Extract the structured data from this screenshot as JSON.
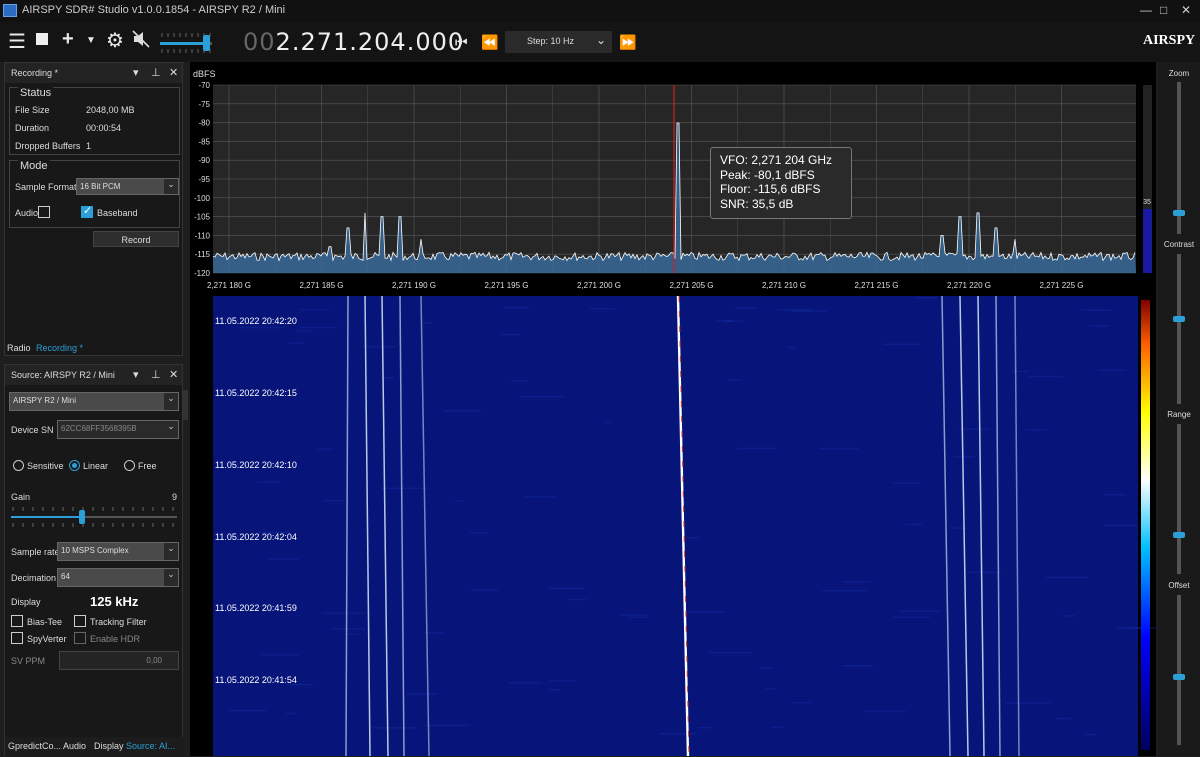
{
  "window": {
    "title": "AIRSPY SDR# Studio v1.0.0.1854 - AIRSPY R2 / Mini",
    "controls": [
      "—",
      "□",
      "✕"
    ]
  },
  "toolbar": {
    "freq_dim": "00",
    "freq_main": "2.271.204.000",
    "step_label": "Step: 10 Hz",
    "logo": "AIRSPY",
    "volume": 0.88
  },
  "recording_panel": {
    "title": "Recording *",
    "status_title": "Status",
    "file_size_label": "File Size",
    "file_size_value": "2048,00 MB",
    "duration_label": "Duration",
    "duration_value": "00:00:54",
    "dropped_label": "Dropped Buffers",
    "dropped_value": "1",
    "mode_title": "Mode",
    "sample_format_label": "Sample Format",
    "sample_format_value": "16 Bit PCM",
    "audio_label": "Audio",
    "audio_checked": false,
    "baseband_label": "Baseband",
    "baseband_checked": true,
    "record_button": "Record",
    "tab_radio": "Radio",
    "tab_recording": "Recording *"
  },
  "source_panel": {
    "title": "Source: AIRSPY R2 / Mini",
    "device_value": "AIRSPY R2 / Mini",
    "device_sn_label": "Device SN",
    "device_sn_value": "62CC68FF3568395B",
    "mode_sensitive": "Sensitive",
    "mode_linear": "Linear",
    "mode_free": "Free",
    "mode_selected": "Linear",
    "gain_label": "Gain",
    "gain_value": "9",
    "gain_fraction": 0.43,
    "sample_rate_label": "Sample rate",
    "sample_rate_value": "10 MSPS Complex",
    "decimation_label": "Decimation",
    "decimation_value": "64",
    "display_label": "Display",
    "display_value": "125 kHz",
    "bias_tee_label": "Bias-Tee",
    "tracking_filter_label": "Tracking Filter",
    "spyverter_label": "SpyVerter",
    "enable_hdr_label": "Enable HDR",
    "sv_ppm_label": "SV PPM",
    "sv_ppm_value": "0,00",
    "tabs": [
      "GpredictCo...",
      "Audio",
      "Display",
      "Source: AI..."
    ]
  },
  "spectrum": {
    "y_unit": "dBFS",
    "y_ticks": [
      "-70",
      "-75",
      "-80",
      "-85",
      "-90",
      "-95",
      "-100",
      "-105",
      "-110",
      "-115",
      "-120"
    ],
    "x_ticks": [
      "2,271 180 G",
      "2,271 185 G",
      "2,271 190 G",
      "2,271 195 G",
      "2,271 200 G",
      "2,271 205 G",
      "2,271 210 G",
      "2,271 215 G",
      "2,271 220 G",
      "2,271 225 G"
    ],
    "vfo_text": "VFO:  2,271 204 GHz",
    "peak_text": "Peak:  -80,1 dBFS",
    "floor_text": "Floor:  -115,6 dBFS",
    "snr_text": "SNR:  35,5 dB",
    "side_scale": "35",
    "colors": {
      "noise_fill": "#3a6a9a",
      "trace": "#ffffff",
      "vfo_line": "#d02020",
      "grid": "#5a5a5a"
    }
  },
  "waterfall": {
    "timestamps": [
      "11.05.2022 20:42:20",
      "11.05.2022 20:42:15",
      "11.05.2022 20:42:10",
      "11.05.2022 20:42:04",
      "11.05.2022 20:41:59",
      "11.05.2022 20:41:54"
    ],
    "background": "#0a1a8a"
  },
  "right_controls": {
    "zoom": "Zoom",
    "contrast": "Contrast",
    "range": "Range",
    "offset": "Offset"
  }
}
